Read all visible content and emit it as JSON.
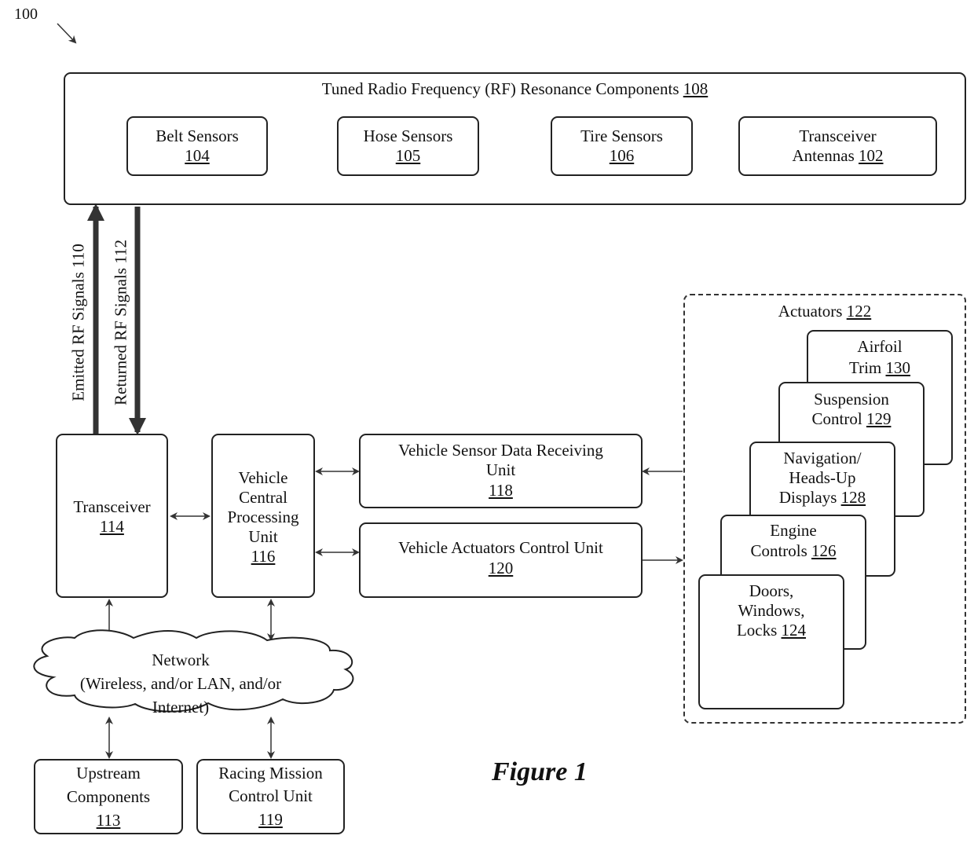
{
  "figure": {
    "ref_number": "100",
    "caption": "Figure 1"
  },
  "rf_components": {
    "title": "Tuned Radio Frequency (RF) Resonance Components",
    "ref": "108",
    "items": [
      {
        "line1": "Belt Sensors",
        "ref": "104"
      },
      {
        "line1": "Hose Sensors",
        "ref": "105"
      },
      {
        "line1": "Tire Sensors",
        "ref": "106"
      },
      {
        "line1": "Transceiver",
        "line2": "Antennas",
        "ref": "102"
      }
    ]
  },
  "signals": {
    "emitted": "Emitted RF Signals 110",
    "returned": "Returned RF Signals 112"
  },
  "transceiver": {
    "label": "Transceiver",
    "ref": "114"
  },
  "cpu": {
    "lines": [
      "Vehicle",
      "Central",
      "Processing",
      "Unit"
    ],
    "ref": "116"
  },
  "sensor_unit": {
    "lines": [
      "Vehicle Sensor Data Receiving",
      "Unit"
    ],
    "ref": "118"
  },
  "actuator_unit": {
    "label": "Vehicle Actuators Control Unit",
    "ref": "120"
  },
  "actuators": {
    "title": "Actuators",
    "ref": "122",
    "items": [
      {
        "lines": [
          "Airfoil",
          "Trim"
        ],
        "ref": "130"
      },
      {
        "lines": [
          "Suspension",
          "Control"
        ],
        "ref": "129"
      },
      {
        "lines": [
          "Navigation/",
          "Heads-Up",
          "Displays"
        ],
        "ref": "128"
      },
      {
        "lines": [
          "Engine",
          "Controls"
        ],
        "ref": "126"
      },
      {
        "lines": [
          "Doors,",
          "Windows,",
          "Locks"
        ],
        "ref": "124"
      }
    ]
  },
  "network": {
    "lines": [
      "Network",
      "(Wireless, and/or LAN, and/or",
      "Internet)"
    ]
  },
  "upstream": {
    "lines": [
      "Upstream",
      "Components"
    ],
    "ref": "113"
  },
  "mission_control": {
    "lines": [
      "Racing Mission",
      "Control Unit"
    ],
    "ref": "119"
  }
}
